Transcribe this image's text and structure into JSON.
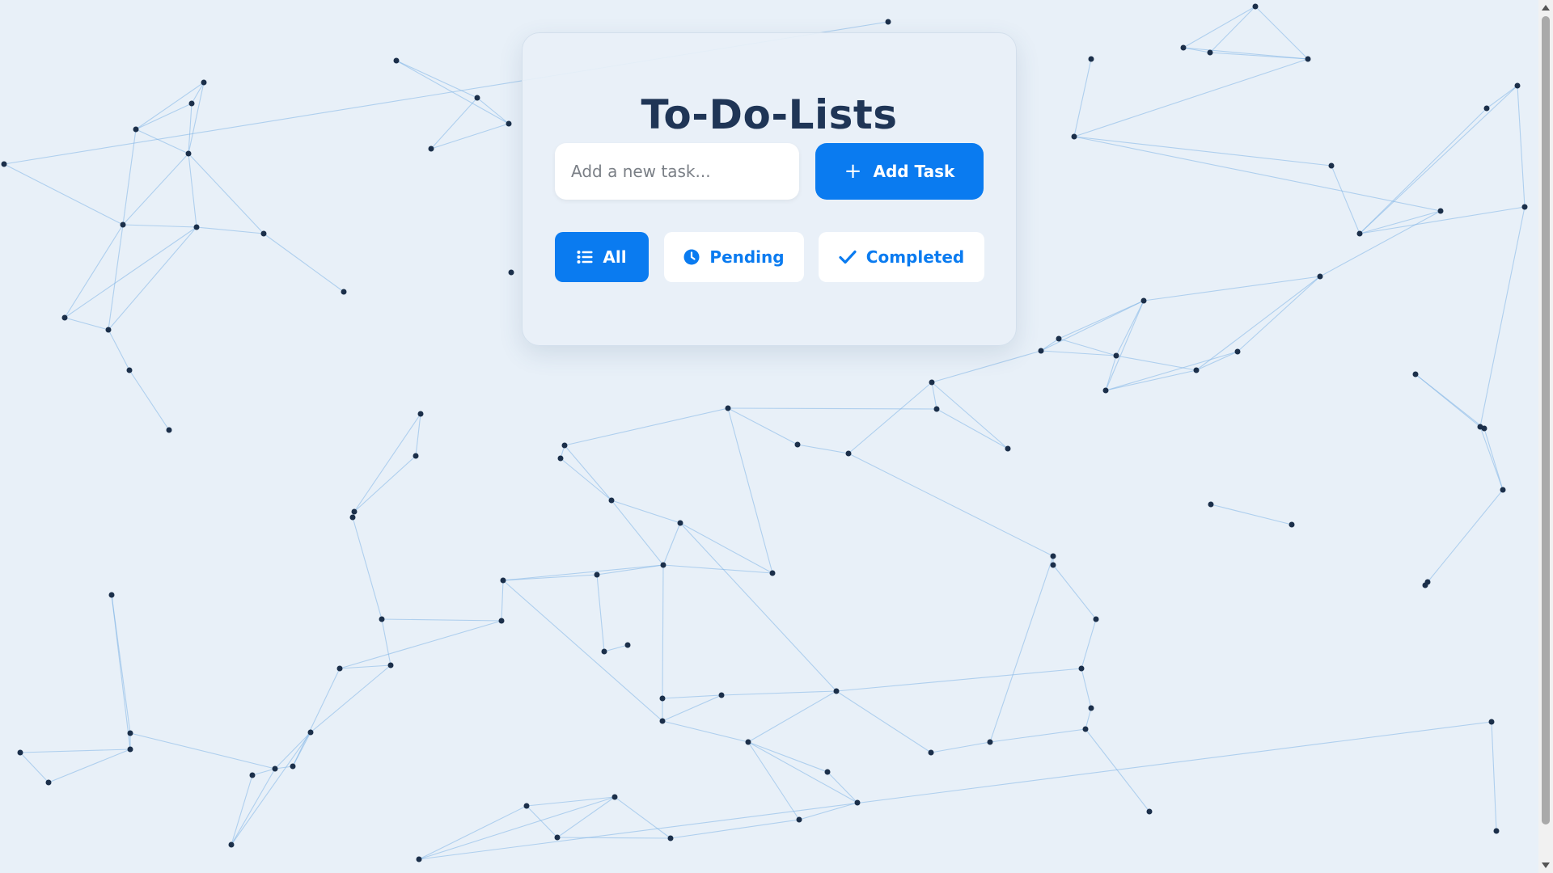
{
  "app": {
    "title": "To-Do-Lists"
  },
  "new_task": {
    "placeholder": "Add a new task...",
    "value": "",
    "add_label": "Add Task",
    "add_icon": "plus-icon"
  },
  "filters": [
    {
      "label": "All",
      "icon": "list-icon",
      "active": true
    },
    {
      "label": "Pending",
      "icon": "clock-icon",
      "active": false
    },
    {
      "label": "Completed",
      "icon": "check-icon",
      "active": false
    }
  ],
  "colors": {
    "accent": "#0a7bf0",
    "title": "#1f3556",
    "background": "#e8f0f8",
    "node": "#1b2f4a",
    "edge": "#7fb4e6"
  }
}
